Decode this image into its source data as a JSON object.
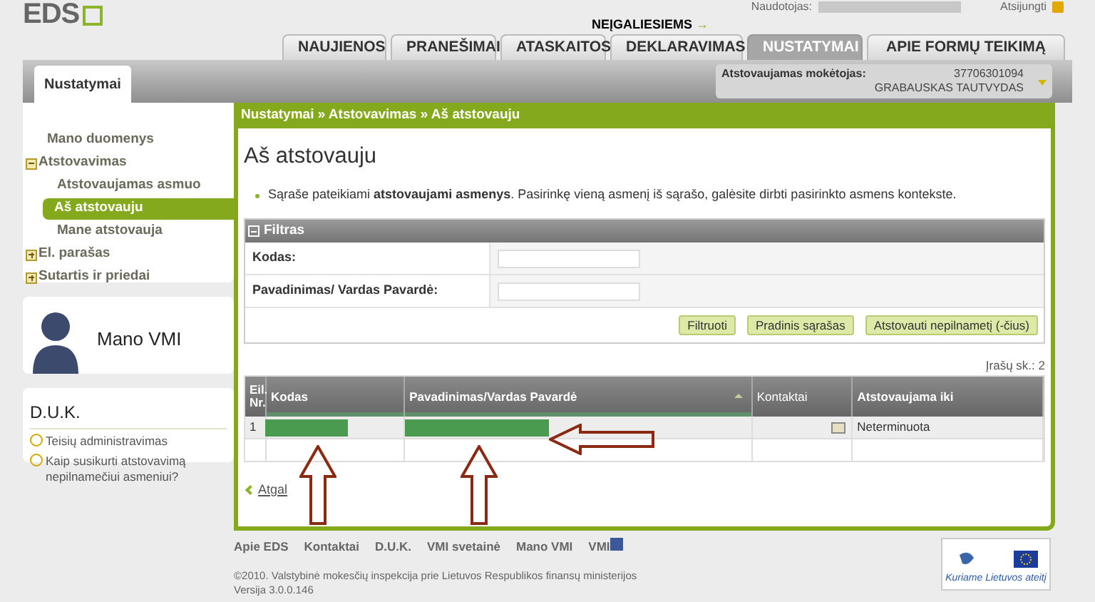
{
  "header": {
    "logo": "EDS",
    "user_label": "Naudotojas:",
    "logout": "Atsijungti",
    "accessibility_link": "NEĮGALIESIEMS",
    "accessibility_arrow": "→"
  },
  "tabs": [
    {
      "label": "NAUJIENOS",
      "selected": false
    },
    {
      "label": "PRANEŠIMAI",
      "selected": false
    },
    {
      "label": "ATASKAITOS",
      "selected": false
    },
    {
      "label": "DEKLARAVIMAS",
      "selected": false
    },
    {
      "label": "NUSTATYMAI",
      "selected": true
    },
    {
      "label": "APIE FORMŲ TEIKIMĄ",
      "selected": false
    }
  ],
  "subtabs": [
    {
      "label": "Nustatymai",
      "selected": true
    }
  ],
  "payer": {
    "label": "Atstovaujamas mokėtojas:",
    "code": "37706301094",
    "name": "GRABAUSKAS TAUTVYDAS"
  },
  "sidebar": {
    "items": [
      {
        "label": "Mano duomenys",
        "kind": "link",
        "selected": false
      },
      {
        "label": "Atstovavimas",
        "kind": "group",
        "expanded": true,
        "selected": false,
        "children": [
          {
            "label": "Atstovaujamas asmuo",
            "kind": "link",
            "selected": false
          },
          {
            "label": "Aš atstovauju",
            "kind": "link",
            "selected": true
          },
          {
            "label": "Mane atstovauja",
            "kind": "link",
            "selected": false
          }
        ]
      },
      {
        "label": "El. parašas",
        "kind": "group",
        "expanded": false,
        "selected": false
      },
      {
        "label": "Sutartis ir priedai",
        "kind": "group",
        "expanded": false,
        "selected": false
      }
    ]
  },
  "mano_vmi": {
    "title": "Mano VMI"
  },
  "faq": {
    "title": "D.U.K.",
    "items": [
      "Teisių administravimas",
      "Kaip susikurti atstovavimą nepilnamečiui asmeniui?"
    ]
  },
  "breadcrumb": {
    "items": [
      "Nustatymai",
      "Atstovavimas",
      "Aš atstovauju"
    ],
    "separator": "»"
  },
  "page_title": "Aš atstovauju",
  "info": "Sąraše pateikiami **atstovaujami asmenys**. Pasirinkę vieną asmenį iš sąrašo, galėsite dirbti pasirinkto asmens kontekste.",
  "filter": {
    "title": "Filtras",
    "expanded": true,
    "fields": [
      {
        "label": "Kodas:"
      },
      {
        "label": "Pavadinimas/ Vardas Pavardė:"
      }
    ],
    "buttons": [
      "Filtruoti",
      "Pradinis sąrašas",
      "Atstovauti nepilnametį (-čius)"
    ]
  },
  "record_count": "Įrašų sk.: 2",
  "table": {
    "columns": [
      {
        "label": "Eil. Nr.",
        "sorted": false
      },
      {
        "label": "Kodas",
        "sorted": false
      },
      {
        "label": "Pavadinimas/Vardas Pavardė",
        "sorted": true
      },
      {
        "label": "Kontaktai",
        "sorted": false
      },
      {
        "label": "Atstovaujama iki",
        "sorted": false
      }
    ],
    "rows": [
      {
        "number": "1",
        "code_redacted": true,
        "name_redacted": true,
        "has_contacts": true,
        "until": "Neterminuota"
      }
    ]
  },
  "back_link": "Atgal",
  "annotations": [
    {
      "kind": "up"
    },
    {
      "kind": "up"
    },
    {
      "kind": "left"
    }
  ],
  "footer": {
    "links": [
      "Apie EDS",
      "Kontaktai",
      "D.U.K.",
      "VMI svetainė",
      "Mano VMI",
      "VMI"
    ],
    "copyright": "©2010. Valstybinė mokesčių inspekcija prie Lietuvos Respublikos finansų ministerijos",
    "version": "Versija 3.0.0.146",
    "eu_slogan": "Kuriame Lietuvos ateitį"
  }
}
